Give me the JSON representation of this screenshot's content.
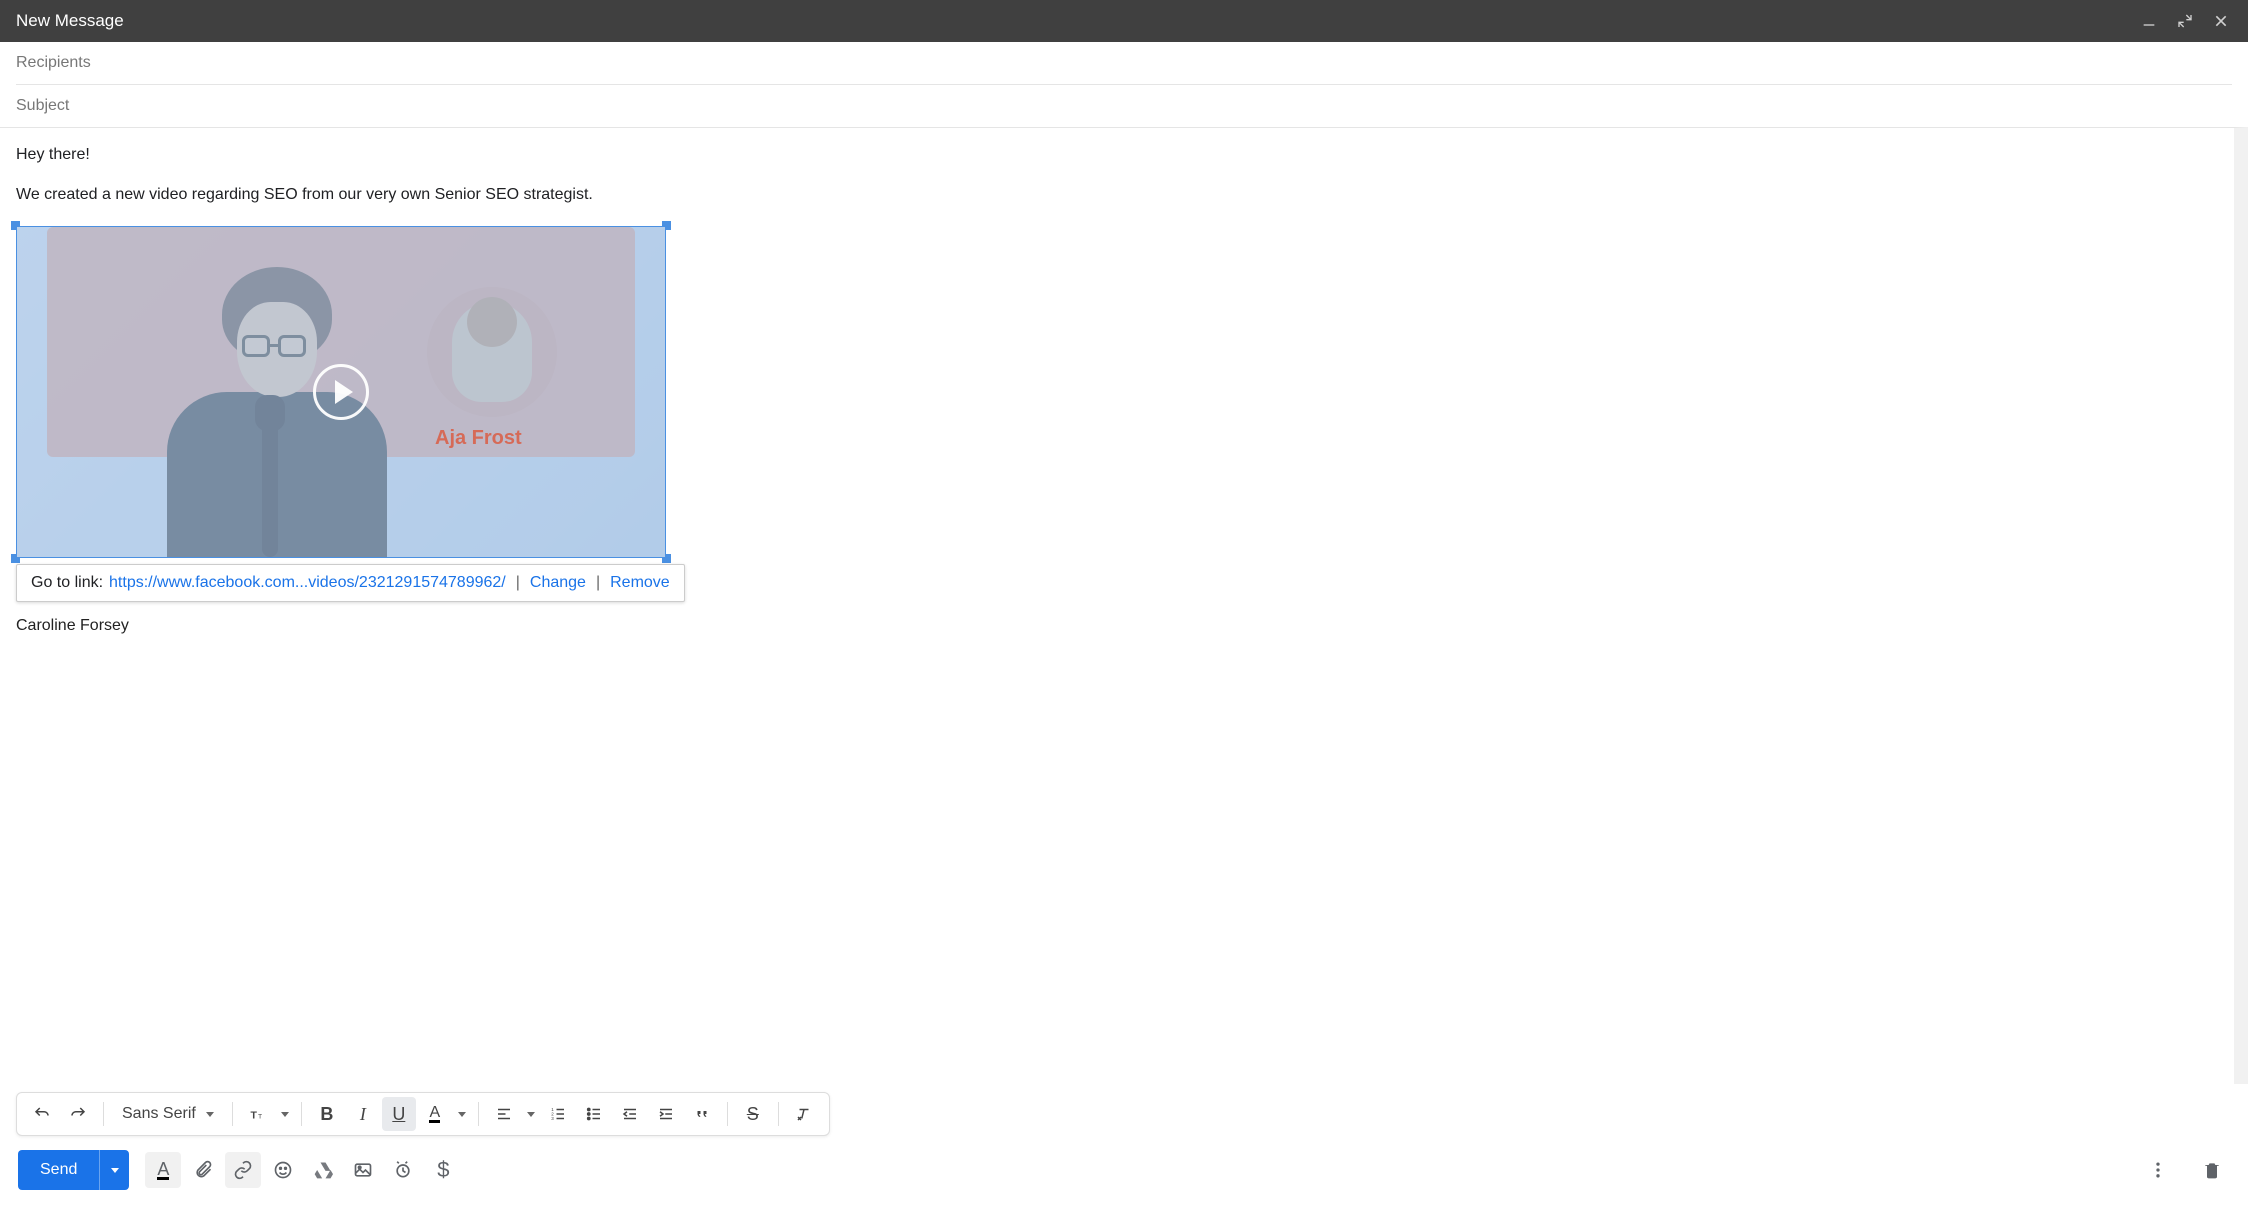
{
  "header": {
    "title": "New Message"
  },
  "fields": {
    "recipients": "Recipients",
    "subject": "Subject"
  },
  "body": {
    "greeting": "Hey there!",
    "line1": "We created a new video regarding SEO from our very own Senior SEO strategist.",
    "thumbnail_name": "Aja Frost",
    "signature": "Caroline Forsey"
  },
  "link_popup": {
    "prefix": "Go to link: ",
    "url": "https://www.facebook.com...videos/2321291574789962/",
    "change": "Change",
    "remove": "Remove"
  },
  "toolbar": {
    "font": "Sans Serif"
  },
  "send": {
    "label": "Send"
  }
}
